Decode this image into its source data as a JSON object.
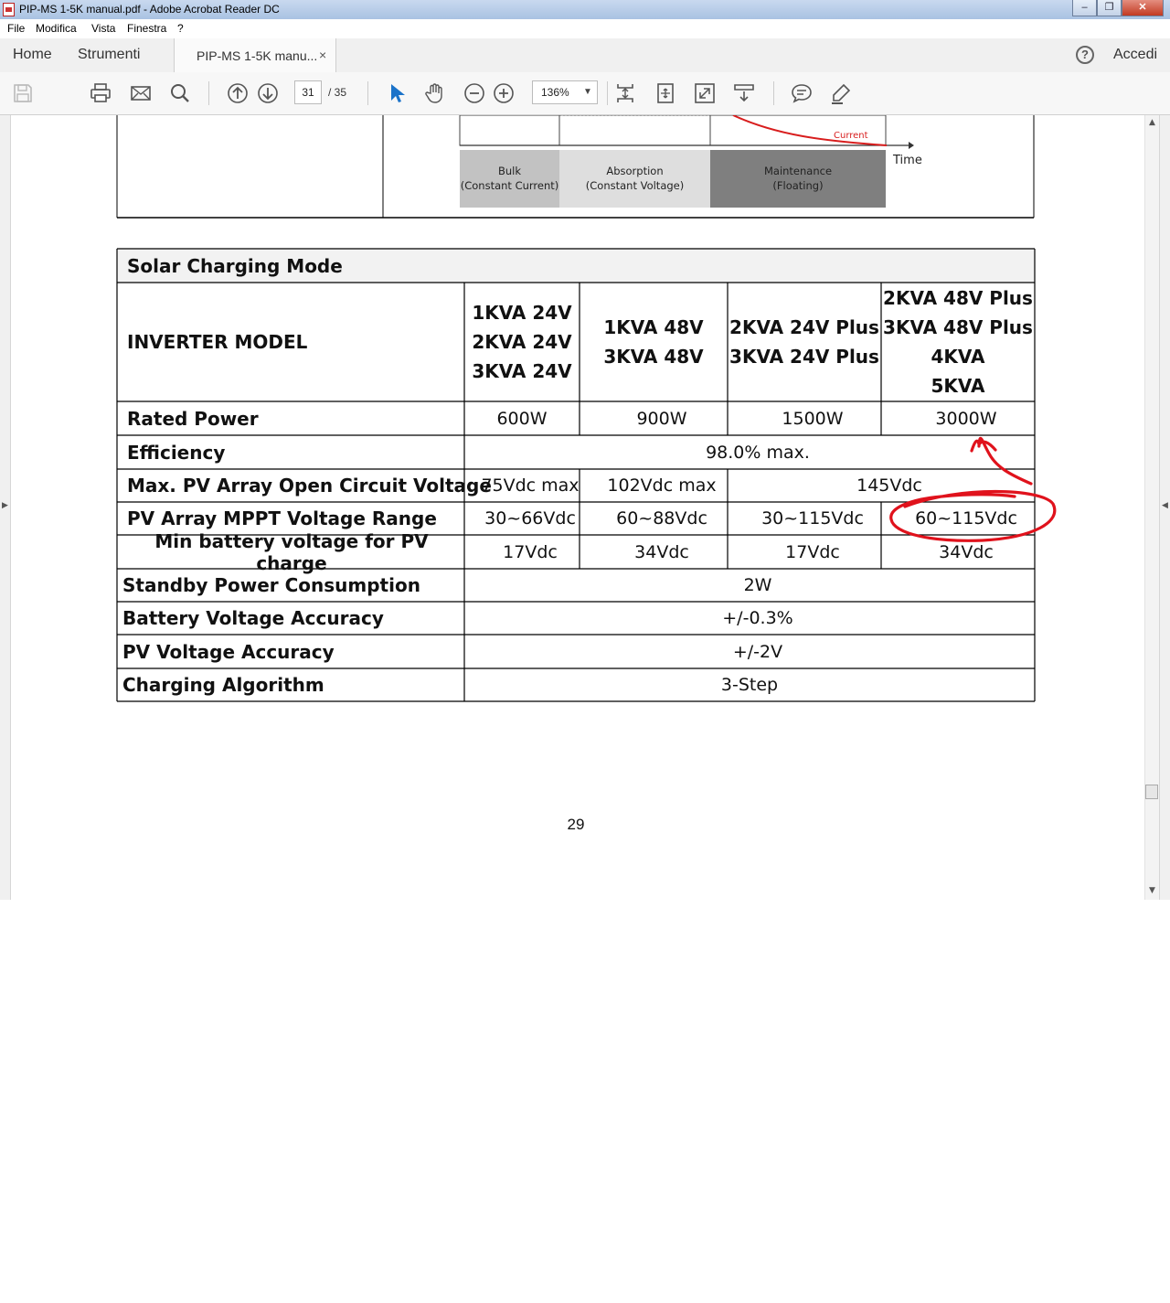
{
  "window": {
    "title": "PIP-MS 1-5K manual.pdf - Adobe Acrobat Reader DC",
    "minimize": "–",
    "maximize": "❐",
    "close": "✕"
  },
  "menu": {
    "file": "File",
    "edit": "Modifica",
    "view": "Vista",
    "window": "Finestra",
    "help": "?"
  },
  "tabs": {
    "home": "Home",
    "tools": "Strumenti",
    "document": "PIP-MS 1-5K manu...",
    "close": "×",
    "help": "?",
    "signin": "Accedi"
  },
  "toolbar": {
    "page_current": "31",
    "page_total": "/ 35",
    "zoom": "136%"
  },
  "charging_chart": {
    "current_label": "Current",
    "time_label": "Time",
    "stages": [
      {
        "line1": "Bulk",
        "line2": "(Constant Current)"
      },
      {
        "line1": "Absorption",
        "line2": "(Constant Voltage)"
      },
      {
        "line1": "Maintenance",
        "line2": "(Floating)"
      }
    ]
  },
  "solar_table": {
    "title": "Solar Charging Mode",
    "model_header": "INVERTER MODEL",
    "models": [
      [
        "1KVA 24V",
        "2KVA 24V",
        "3KVA 24V"
      ],
      [
        "1KVA 48V",
        "3KVA 48V"
      ],
      [
        "2KVA 24V Plus",
        "3KVA 24V Plus"
      ],
      [
        "2KVA 48V Plus",
        "3KVA 48V Plus",
        "4KVA",
        "5KVA"
      ]
    ],
    "rated_power": {
      "label": "Rated Power",
      "values": [
        "600W",
        "900W",
        "1500W",
        "3000W"
      ]
    },
    "efficiency": {
      "label": "Efficiency",
      "value": "98.0% max."
    },
    "max_pv_voltage": {
      "label": "Max. PV Array Open Circuit Voltage",
      "values": [
        "75Vdc max",
        "102Vdc max",
        "145Vdc"
      ]
    },
    "mppt_range": {
      "label": "PV Array MPPT Voltage Range",
      "values": [
        "30~66Vdc",
        "60~88Vdc",
        "30~115Vdc",
        "60~115Vdc"
      ]
    },
    "min_battery": {
      "label": "Min battery voltage for PV charge",
      "values": [
        "17Vdc",
        "34Vdc",
        "17Vdc",
        "34Vdc"
      ]
    },
    "standby": {
      "label": "Standby Power Consumption",
      "value": "2W"
    },
    "battery_accuracy": {
      "label": "Battery Voltage Accuracy",
      "value": "+/-0.3%"
    },
    "pv_accuracy": {
      "label": "PV Voltage Accuracy",
      "value": "+/-2V"
    },
    "algorithm": {
      "label": "Charging Algorithm",
      "value": "3-Step"
    }
  },
  "page_number": "29",
  "annotation_color": "#e0121c"
}
